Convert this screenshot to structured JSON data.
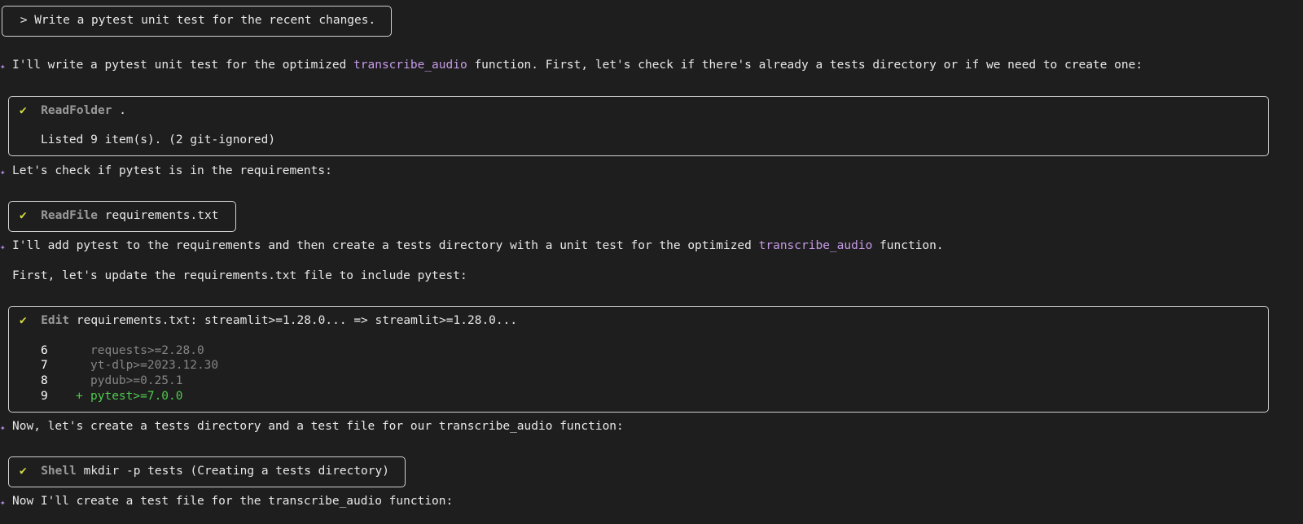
{
  "prompt": {
    "text": " > Write a pytest unit test for the recent changes."
  },
  "messages": {
    "m1": {
      "pre": "I'll write a pytest unit test for the optimized ",
      "fn": "transcribe_audio",
      "post": " function. First, let's check if there's already a tests directory or if we need to create one:"
    },
    "m2": {
      "text": "Let's check if pytest is in the requirements:"
    },
    "m3": {
      "pre": "I'll add pytest to the requirements and then create a tests directory with a unit test for the optimized ",
      "fn": "transcribe_audio",
      "post": " function."
    },
    "m3b": {
      "text": "First, let's update the requirements.txt file to include pytest:"
    },
    "m4": {
      "text": "Now, let's create a tests directory and a test file for our transcribe_audio function:"
    },
    "m5": {
      "text": "Now I'll create a test file for the transcribe_audio function:"
    }
  },
  "tools": {
    "readfolder": {
      "check": "✔",
      "name": "ReadFolder",
      "arg": " .",
      "result": "Listed 9 item(s). (2 git-ignored)"
    },
    "readfile": {
      "check": "✔",
      "name": "ReadFile",
      "arg": " requirements.txt"
    },
    "edit": {
      "check": "✔",
      "name": "Edit",
      "arg": " requirements.txt: streamlit>=1.28.0... => streamlit>=1.28.0...",
      "diff": [
        {
          "num": "6",
          "marker": " ",
          "text": "requests>=2.28.0",
          "added": false
        },
        {
          "num": "7",
          "marker": " ",
          "text": "yt-dlp>=2023.12.30",
          "added": false
        },
        {
          "num": "8",
          "marker": " ",
          "text": "pydub>=0.25.1",
          "added": false
        },
        {
          "num": "9",
          "marker": "+",
          "text": "pytest>=7.0.0",
          "added": true
        }
      ]
    },
    "shell": {
      "check": "✔",
      "name": "Shell",
      "arg": " mkdir -p tests (Creating a tests directory)"
    }
  },
  "icons": {
    "sparkle": "sparkle-icon",
    "check": "checkmark-icon"
  },
  "colors": {
    "background": "#1e1e1e",
    "text": "#e8e8e8",
    "function_highlight": "#c79be8",
    "checkmark": "#d6dc3f",
    "tool_name": "#9a9a9a",
    "added_line": "#4ec94e",
    "sparkle": "#b58ae6",
    "box_border": "#d0d0d0"
  }
}
